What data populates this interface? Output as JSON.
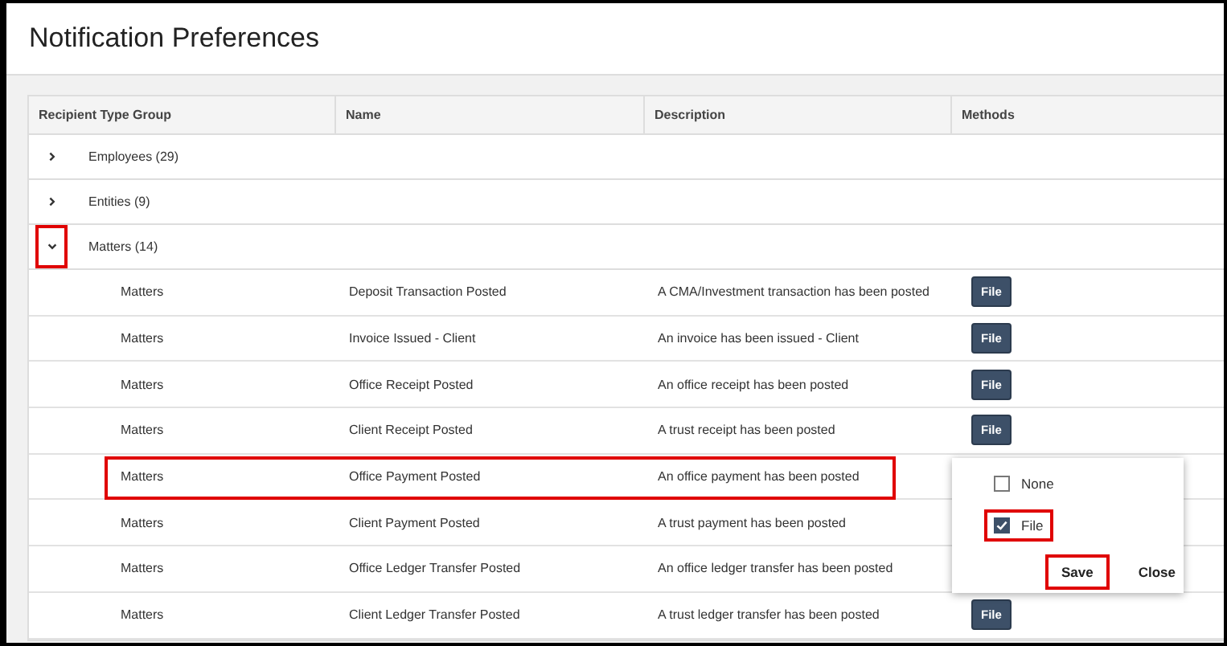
{
  "dialog": {
    "title": "Notification Preferences"
  },
  "table": {
    "columns": [
      "Recipient Type Group",
      "Name",
      "Description",
      "Methods"
    ],
    "groups": [
      {
        "label": "Employees (29)",
        "expanded": false,
        "annotated": false
      },
      {
        "label": "Entities (9)",
        "expanded": false,
        "annotated": false
      },
      {
        "label": "Matters (14)",
        "expanded": true,
        "annotated": true,
        "children": [
          {
            "group": "Matters",
            "name": "Deposit Transaction Posted",
            "description": "A CMA/Investment transaction has been posted",
            "method": "File",
            "annotated": false
          },
          {
            "group": "Matters",
            "name": "Invoice Issued - Client",
            "description": "An invoice has been issued - Client",
            "method": "File",
            "annotated": false
          },
          {
            "group": "Matters",
            "name": "Office Receipt Posted",
            "description": "An office receipt has been posted",
            "method": "File",
            "annotated": false
          },
          {
            "group": "Matters",
            "name": "Client Receipt Posted",
            "description": "A trust receipt has been posted",
            "method": "File",
            "annotated": false
          },
          {
            "group": "Matters",
            "name": "Office Payment Posted",
            "description": "An office payment has been posted",
            "annotated": true
          },
          {
            "group": "Matters",
            "name": "Client Payment Posted",
            "description": "A trust payment has been posted",
            "annotated": false
          },
          {
            "group": "Matters",
            "name": "Office Ledger Transfer Posted",
            "description": "An office ledger transfer has been posted",
            "annotated": false
          },
          {
            "group": "Matters",
            "name": "Client Ledger Transfer Posted",
            "description": "A trust ledger transfer has been posted",
            "method": "File",
            "annotated": false
          }
        ]
      }
    ]
  },
  "methods_popup": {
    "options": [
      {
        "label": "None",
        "checked": false,
        "annotated": false
      },
      {
        "label": "File",
        "checked": true,
        "annotated": true
      }
    ],
    "buttons": [
      {
        "label": "Save",
        "annotated": true
      },
      {
        "label": "Close",
        "annotated": false
      }
    ]
  }
}
